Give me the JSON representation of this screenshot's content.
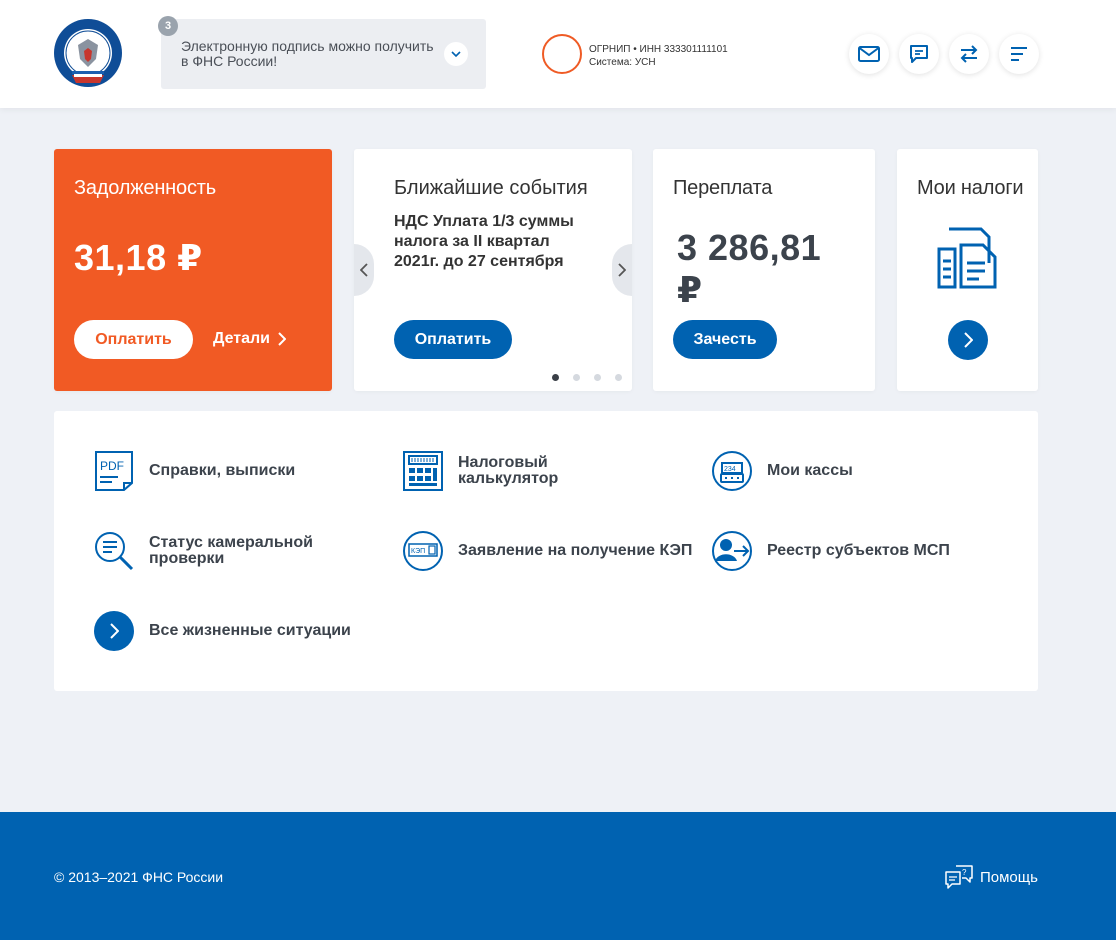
{
  "header": {
    "notice": {
      "badge": "3",
      "text": "Электронную подпись можно получить в ФНС России!"
    },
    "profile": {
      "line1": "ОГРНИП  • ИНН 333301111101",
      "line2": "Система: УСН"
    },
    "icons": [
      "mail-icon",
      "chat-icon",
      "swap-icon",
      "menu-icon"
    ]
  },
  "cards": {
    "debt": {
      "title": "Задолженность",
      "amount": "31,18 ₽",
      "pay_label": "Оплатить",
      "details_label": "Детали"
    },
    "events": {
      "title": "Ближайшие события",
      "text": "НДС Уплата 1/3 суммы налога за II квартал 2021г. до 27 сентября",
      "pay_label": "Оплатить",
      "slides": 4,
      "active_slide": 1
    },
    "overpay": {
      "title": "Переплата",
      "amount": "3 286,81 ₽",
      "button_label": "Зачесть"
    },
    "taxes": {
      "title": "Мои налоги"
    }
  },
  "services": [
    {
      "id": "certificates",
      "label": "Справки, выписки",
      "icon": "pdf-document-icon"
    },
    {
      "id": "calculator",
      "label": "Налоговый калькулятор",
      "icon": "calculator-icon"
    },
    {
      "id": "kassy",
      "label": "Мои кассы",
      "icon": "cash-register-icon"
    },
    {
      "id": "status",
      "label": "Статус камеральной проверки",
      "icon": "magnifier-document-icon"
    },
    {
      "id": "kep",
      "label": "Заявление на получение КЭП",
      "icon": "kep-card-icon"
    },
    {
      "id": "msp",
      "label": "Реестр субъектов МСП",
      "icon": "registry-person-icon"
    },
    {
      "id": "all",
      "label": "Все жизненные ситуации",
      "icon": "chevron-right-icon"
    }
  ],
  "footer": {
    "copyright": "© 2013–2021 ФНС России",
    "help_label": "Помощь"
  },
  "colors": {
    "brand_blue": "#0062b1",
    "debt_orange": "#f15a24",
    "background": "#eef1f6"
  }
}
